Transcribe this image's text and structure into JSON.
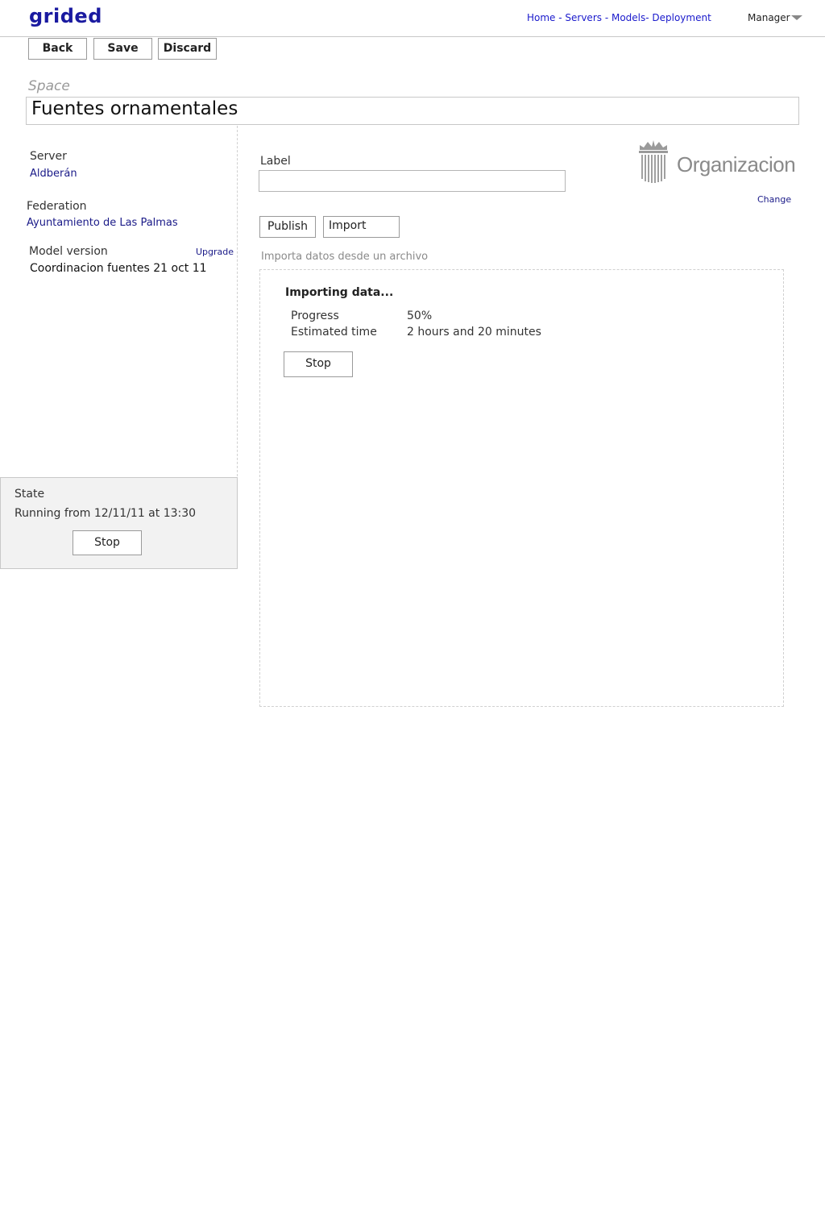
{
  "app": {
    "logo": "grided"
  },
  "header": {
    "nav_text": "Home - Servers - Models- Deployment",
    "user": "Manager"
  },
  "toolbar": {
    "back": "Back",
    "save": "Save",
    "discard": "Discard"
  },
  "space": {
    "label": "Space",
    "name": "Fuentes ornamentales"
  },
  "sidebar": {
    "server_label": "Server",
    "server_value": "Aldberán",
    "federation_label": "Federation",
    "federation_value": "Ayuntamiento de Las Palmas",
    "model_label": "Model version",
    "upgrade_link": "Upgrade",
    "model_value": "Coordinacion fuentes 21 oct 11"
  },
  "state": {
    "title": "State",
    "status": "Running from 12/11/11 at 13:30",
    "stop_label": "Stop"
  },
  "main": {
    "label_field_label": "Label",
    "label_field_value": "",
    "org_name": "Organizacion",
    "change_link": "Change",
    "publish_label": "Publish",
    "import_label": "Import",
    "import_hint": "Importa datos desde un archivo"
  },
  "import_panel": {
    "title": "Importing data...",
    "progress_label": "Progress",
    "progress_value": "50%",
    "eta_label": "Estimated time",
    "eta_value": "2 hours and 20 minutes",
    "stop_label": "Stop"
  },
  "colors": {
    "link": "#1a1acc",
    "logo": "#1a1aa0",
    "panel_bg": "#f2f2f2"
  },
  "icons": {
    "user_menu": "chevron-down-icon",
    "org_logo": "crown-columns-icon"
  }
}
